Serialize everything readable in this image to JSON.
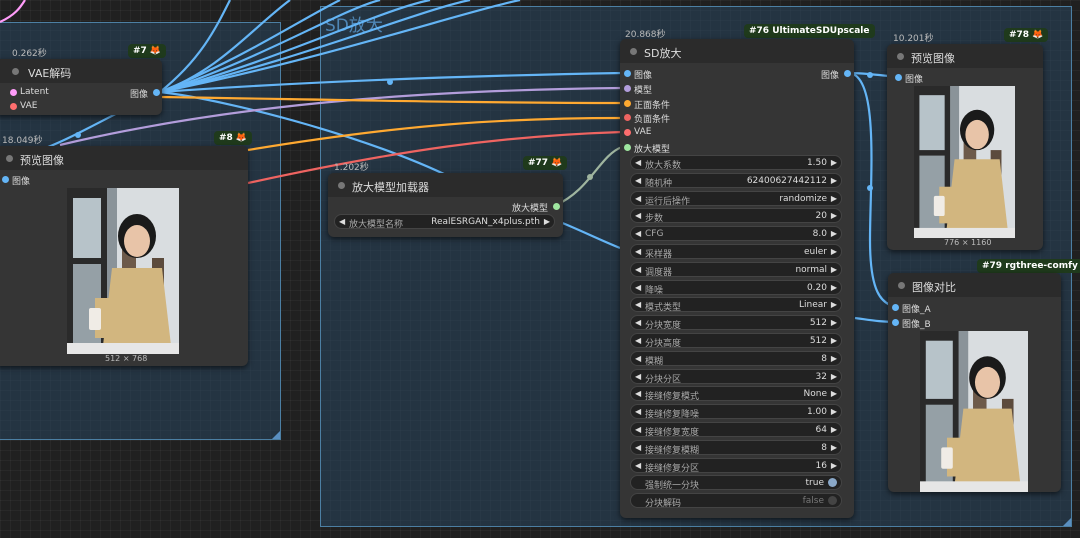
{
  "groups": {
    "sd_upscale": {
      "title": "SD放大"
    }
  },
  "nodes": {
    "vae_decode": {
      "id": "#7",
      "time": "0.262秒",
      "title": "VAE解码",
      "inputs": [
        "Latent",
        "VAE"
      ],
      "output": "图像"
    },
    "preview1": {
      "id": "#8",
      "time": "18.049秒",
      "title": "预览图像",
      "input": "图像",
      "image_size": "512 × 768"
    },
    "upscale_loader": {
      "id": "#77",
      "time": "1.202秒",
      "title": "放大模型加载器",
      "output": "放大模型",
      "model_label": "放大模型名称",
      "model_value": "RealESRGAN_x4plus.pth"
    },
    "ultimate": {
      "id": "#76 UltimateSDUpscale",
      "time": "20.868秒",
      "title": "SD放大",
      "inputs": [
        "图像",
        "模型",
        "正面条件",
        "负面条件",
        "VAE",
        "放大模型"
      ],
      "output": "图像",
      "widgets": [
        {
          "label": "放大系数",
          "value": "1.50"
        },
        {
          "label": "随机种",
          "value": "624006274421 12"
        },
        {
          "label": "运行后操作",
          "value": "randomize"
        },
        {
          "label": "步数",
          "value": "20"
        },
        {
          "label": "CFG",
          "value": "8.0"
        },
        {
          "label": "采样器",
          "value": "euler"
        },
        {
          "label": "调度器",
          "value": "normal"
        },
        {
          "label": "降噪",
          "value": "0.20"
        },
        {
          "label": "模式类型",
          "value": "Linear"
        },
        {
          "label": "分块宽度",
          "value": "512"
        },
        {
          "label": "分块高度",
          "value": "512"
        },
        {
          "label": "模糊",
          "value": "8"
        },
        {
          "label": "分块分区",
          "value": "32"
        },
        {
          "label": "接缝修复模式",
          "value": "None"
        },
        {
          "label": "接缝修复降噪",
          "value": "1.00"
        },
        {
          "label": "接缝修复宽度",
          "value": "64"
        },
        {
          "label": "接缝修复模糊",
          "value": "8"
        },
        {
          "label": "接缝修复分区",
          "value": "16"
        }
      ],
      "toggles": [
        {
          "label": "强制统一分块",
          "value": "true",
          "on": true
        },
        {
          "label": "分块解码",
          "value": "false",
          "on": false
        }
      ]
    },
    "preview2": {
      "id": "#78",
      "time": "10.201秒",
      "title": "预览图像",
      "input": "图像",
      "image_size": "776 × 1160"
    },
    "compare": {
      "id": "#79 rgthree-comfy",
      "title": "图像对比",
      "inputs": [
        "图像_A",
        "图像_B"
      ]
    }
  },
  "colors": {
    "image": "#64b5f6",
    "model": "#b39ddb",
    "positive": "#ffa931",
    "negative": "#ef6461",
    "vae": "#ff6e6e",
    "latent": "#ff9cf9",
    "upscale_model": "#9fe69f"
  }
}
